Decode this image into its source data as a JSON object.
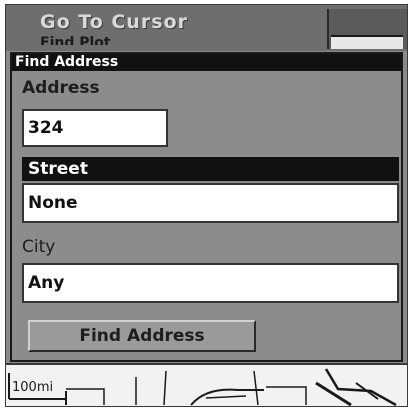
{
  "menu": {
    "goto_label": "Go To Cursor",
    "find_label_partial": "Find Plot"
  },
  "dialog": {
    "title": "Find Address",
    "address": {
      "label": "Address",
      "value": "324"
    },
    "street": {
      "label": "Street",
      "value": "None"
    },
    "city": {
      "label": "City",
      "value": "Any"
    },
    "find_button_label": "Find Address"
  },
  "map": {
    "scale_label": "100mi"
  },
  "colors": {
    "screen_gray": "#8c8c8c",
    "title_bar": "#111111",
    "field_bg": "#ffffff"
  }
}
